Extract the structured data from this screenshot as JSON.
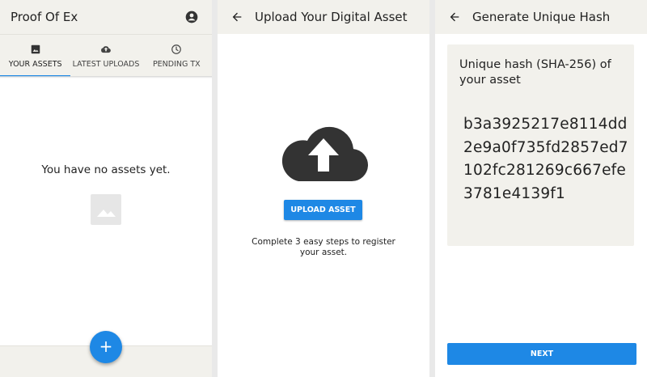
{
  "screen1": {
    "title": "Proof Of Ex",
    "tabs": [
      {
        "label": "YOUR ASSETS",
        "icon": "image-icon",
        "active": true
      },
      {
        "label": "LATEST UPLOADS",
        "icon": "cloud-upload-icon",
        "active": false
      },
      {
        "label": "PENDING TX",
        "icon": "clock-icon",
        "active": false
      }
    ],
    "empty_message": "You have no assets yet.",
    "fab_label": "+"
  },
  "screen2": {
    "title": "Upload Your Digital Asset",
    "upload_button": "UPLOAD ASSET",
    "hint": "Complete 3 easy steps to register your asset."
  },
  "screen3": {
    "title": "Generate Unique Hash",
    "hash_title": "Unique hash (SHA-256) of your asset",
    "hash_value": "b3a3925217e8114dd2e9a0f735fd2857ed7102fc281269c667efe3781e4139f1",
    "next_button": "NEXT"
  },
  "colors": {
    "accent": "#1e88e5",
    "appbar": "#f2f1ec",
    "text": "#222222"
  }
}
